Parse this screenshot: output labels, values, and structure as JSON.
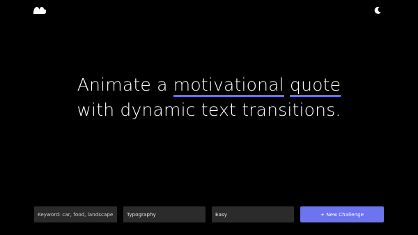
{
  "app": {
    "logo_icon": "blob-logo-icon",
    "theme_toggle_icon": "moon-icon"
  },
  "challenge": {
    "part1": "Animate a ",
    "highlight1": "motivational",
    "part2": " ",
    "highlight2": "quote",
    "part3": " with dynamic text transitions."
  },
  "controls": {
    "keyword_placeholder": "Keyword: car, food, landscape",
    "keyword_value": "",
    "category_value": "Typography",
    "difficulty_value": "Easy",
    "new_challenge_label": "+ New Challenge"
  },
  "colors": {
    "background": "#000000",
    "accent": "#6c74f0",
    "field_background": "#2b2b2b",
    "text": "#ffffff"
  }
}
